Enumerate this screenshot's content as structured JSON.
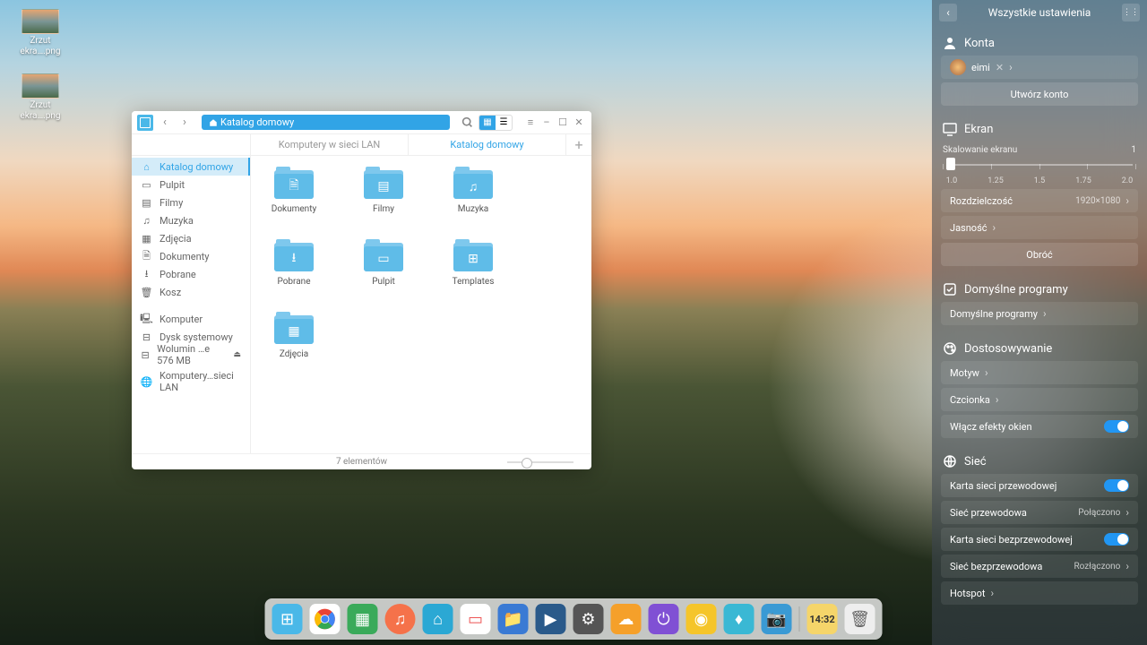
{
  "desktop_icons": [
    {
      "label": "Zrzut ekra….png"
    },
    {
      "label": "Zrzut ekra….png"
    }
  ],
  "fm": {
    "breadcrumb": "Katalog domowy",
    "tabs": [
      {
        "label": "Komputery w sieci LAN",
        "active": false
      },
      {
        "label": "Katalog domowy",
        "active": true
      }
    ],
    "sidebar": [
      {
        "icon": "⌂",
        "label": "Katalog domowy",
        "active": true
      },
      {
        "icon": "▭",
        "label": "Pulpit"
      },
      {
        "icon": "▤",
        "label": "Filmy"
      },
      {
        "icon": "♫",
        "label": "Muzyka"
      },
      {
        "icon": "▦",
        "label": "Zdjęcia"
      },
      {
        "icon": "🗎",
        "label": "Dokumenty"
      },
      {
        "icon": "⭳",
        "label": "Pobrane"
      },
      {
        "icon": "🗑",
        "label": "Kosz"
      },
      {
        "sep": true
      },
      {
        "icon": "🖳",
        "label": "Komputer"
      },
      {
        "icon": "⊟",
        "label": "Dysk systemowy"
      },
      {
        "icon": "⊟",
        "label": "Wolumin …e 576 MB",
        "eject": true
      },
      {
        "sep": true
      },
      {
        "icon": "🌐",
        "label": "Komputery…sieci LAN"
      }
    ],
    "folders": [
      {
        "icon": "🗎",
        "label": "Dokumenty"
      },
      {
        "icon": "▤",
        "label": "Filmy"
      },
      {
        "icon": "♫",
        "label": "Muzyka"
      },
      {
        "icon": "⭳",
        "label": "Pobrane"
      },
      {
        "icon": "▭",
        "label": "Pulpit"
      },
      {
        "icon": "⊞",
        "label": "Templates"
      },
      {
        "icon": "▦",
        "label": "Zdjęcia"
      }
    ],
    "status": "7 elementów"
  },
  "settings": {
    "title": "Wszystkie ustawienia",
    "accounts": {
      "heading": "Konta",
      "user": "eimi",
      "create": "Utwórz konto"
    },
    "display": {
      "heading": "Ekran",
      "scale_label": "Skalowanie ekranu",
      "scale_value": "1",
      "ticks": [
        "1.0",
        "1.25",
        "1.5",
        "1.75",
        "2.0"
      ],
      "resolution_label": "Rozdzielczość",
      "resolution_value": "1920×1080",
      "brightness": "Jasność",
      "rotate": "Obróć"
    },
    "defaults": {
      "heading": "Domyślne programy",
      "row": "Domyślne programy"
    },
    "custom": {
      "heading": "Dostosowywanie",
      "theme": "Motyw",
      "font": "Czcionka",
      "effects": "Włącz efekty okien"
    },
    "network": {
      "heading": "Sieć",
      "wired_card": "Karta sieci przewodowej",
      "wired": "Sieć przewodowa",
      "wired_status": "Połączono",
      "wireless_card": "Karta sieci bezprzewodowej",
      "wireless": "Sieć bezprzewodowa",
      "wireless_status": "Rozłączono",
      "hotspot": "Hotspot"
    }
  },
  "dock": {
    "time": "14:32"
  }
}
